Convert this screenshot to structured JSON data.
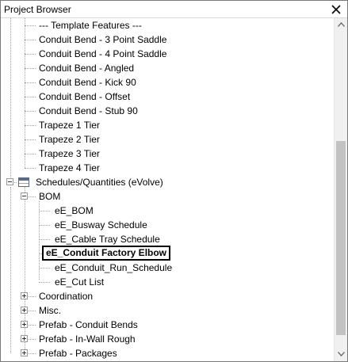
{
  "panel": {
    "title": "Project Browser"
  },
  "tree": {
    "template_items": [
      "---   Template Features   ---",
      "Conduit Bend - 3 Point Saddle",
      "Conduit Bend - 4 Point Saddle",
      "Conduit Bend - Angled",
      "Conduit Bend - Kick 90",
      "Conduit Bend - Offset",
      "Conduit Bend - Stub 90",
      "Trapeze 1 Tier",
      "Trapeze 2 Tier",
      "Trapeze 3 Tier",
      "Trapeze 4 Tier"
    ],
    "schedules_label": "Schedules/Quantities (eVolve)",
    "bom_label": "BOM",
    "bom_items": [
      "eE_BOM",
      "eE_Busway Schedule",
      "eE_Cable Tray Schedule",
      "eE_Conduit Factory Elbow",
      "eE_Conduit_Run_Schedule",
      "eE_Cut List"
    ],
    "collapsed_groups": [
      "Coordination",
      "Misc.",
      "Prefab - Conduit Bends",
      "Prefab - In-Wall Rough",
      "Prefab - Packages"
    ]
  }
}
